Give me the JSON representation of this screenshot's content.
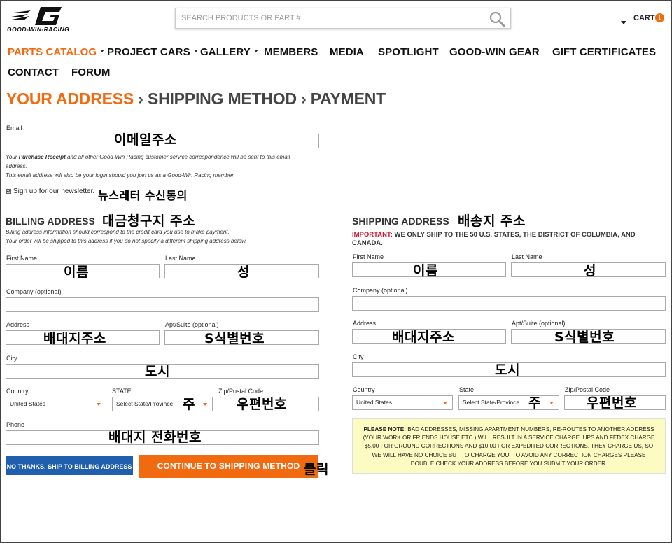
{
  "header": {
    "logo_text": "GOOD-WIN-RACING",
    "search_placeholder": "SEARCH PRODUCTS OR PART #",
    "cart_label": "CART",
    "cart_count": "1"
  },
  "nav": {
    "row1": [
      "PARTS CATALOG",
      "PROJECT CARS",
      "GALLERY",
      "MEMBERS",
      "MEDIA",
      "SPOTLIGHT",
      "GOOD-WIN GEAR",
      "GIFT CERTIFICATES"
    ],
    "row2": [
      "CONTACT",
      "FORUM"
    ]
  },
  "breadcrumb": {
    "step1": "YOUR ADDRESS",
    "sep": "›",
    "step2": "SHIPPING METHOD",
    "step3": "PAYMENT"
  },
  "email": {
    "label": "Email",
    "annotation": "이메일주소",
    "note1_pre": "Your ",
    "note1_bold": "Purchase Receipt",
    "note1_post": " and all other Good-Win Racing customer service correspondence will be sent to this email",
    "note2": "address.",
    "note3": "This email address will also be your login should you join us as a Good-Win Racing member."
  },
  "newsletter": {
    "label": "Sign up for our newsletter.",
    "annotation": "뉴스레터 수신동의"
  },
  "billing": {
    "title": "BILLING ADDRESS",
    "annotation": "대금청구지 주소",
    "note1": "Billing address information should correspond to the credit card you use to make payment.",
    "note2": "Your order will be shipped to this address if you do not specify a different shipping address below.",
    "first_name_label": "First Name",
    "first_name_ann": "이름",
    "last_name_label": "Last Name",
    "last_name_ann": "성",
    "company_label": "Company (optional)",
    "address_label": "Address",
    "address_ann": "배대지주소",
    "apt_label": "Apt/Suite (optional)",
    "apt_ann": "S식별번호",
    "city_label": "City",
    "city_ann": "도시",
    "country_label": "Country",
    "country_value": "United States",
    "state_label": "STATE",
    "state_value": "Select State/Province",
    "state_ann": "주",
    "zip_label": "Zip/Postal Code",
    "zip_ann": "우편번호",
    "phone_label": "Phone",
    "phone_ann": "배대지 전화번호"
  },
  "shipping": {
    "title": "SHIPPING ADDRESS",
    "annotation": "배송지 주소",
    "important_label": "IMPORTANT:",
    "important_text": " WE ONLY SHIP TO THE 50 U.S. STATES, THE DISTRICT OF COLUMBIA, AND CANADA.",
    "first_name_label": "First Name",
    "first_name_ann": "이름",
    "last_name_label": "Last Name",
    "last_name_ann": "성",
    "company_label": "Company (optional)",
    "address_label": "Address",
    "address_ann": "배대지주소",
    "apt_label": "Apt/Suite (optional)",
    "apt_ann": "S식별번호",
    "city_label": "City",
    "city_ann": "도시",
    "country_label": "Country",
    "country_value": "United States",
    "state_label": "State",
    "state_value": "Select State/Province",
    "state_ann": "주",
    "zip_label": "Zip/Postal Code",
    "zip_ann": "우편번호"
  },
  "notice": {
    "bold": "PLEASE NOTE:",
    "text": " BAD ADDRESSES, MISSING APARTMENT NUMBERS, RE-ROUTES TO ANOTHER ADDRESS (YOUR WORK OR FRIENDS HOUSE ETC.) WILL RESULT IN A SERVICE CHARGE. UPS AND FEDEX CHARGE $5.00 FOR GROUND CORRECTIONS AND $10.00 FOR EXPEDITED CORRECTIONS. THEY CHARGE US, SO WE WILL HAVE NO CHOICE BUT TO CHARGE YOU. TO AVOID ANY CORRECTION CHARGES PLEASE DOUBLE CHECK YOUR ADDRESS BEFORE YOU SUBMIT YOUR ORDER."
  },
  "buttons": {
    "ship_to_billing": "NO THANKS, SHIP TO BILLING ADDRESS",
    "continue": "CONTINUE TO SHIPPING METHOD",
    "continue_ann": "클릭"
  },
  "colors": {
    "accent": "#f26a10",
    "button_blue": "#1f5fae",
    "notice_bg": "#fbfbc2",
    "important_red": "#d0102a"
  }
}
